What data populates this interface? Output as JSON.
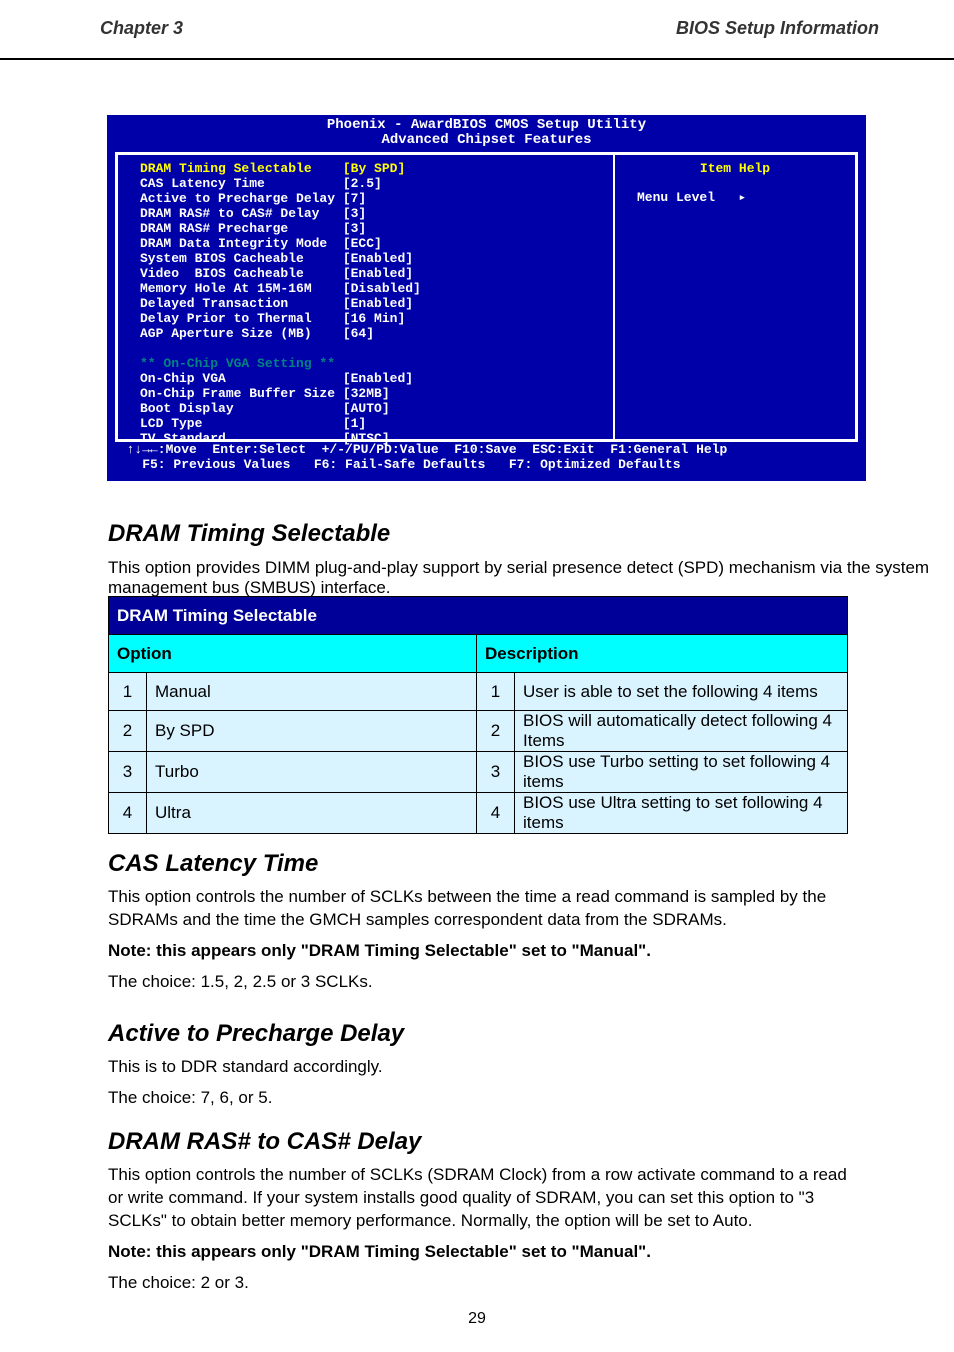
{
  "page": {
    "header_left": "Chapter 3",
    "header_right": "BIOS Setup Information",
    "number": "29"
  },
  "bios": {
    "title_line1": "Phoenix - AwardBIOS CMOS Setup Utility",
    "title_line2": "Advanced Chipset Features",
    "items": [
      {
        "label": "DRAM Timing Selectable",
        "value": "[By SPD]",
        "hl": true
      },
      {
        "label": "CAS Latency Time",
        "value": "[2.5]"
      },
      {
        "label": "Active to Precharge Delay",
        "value": "[7]"
      },
      {
        "label": "DRAM RAS# to CAS# Delay",
        "value": "[3]"
      },
      {
        "label": "DRAM RAS# Precharge",
        "value": "[3]"
      },
      {
        "label": "DRAM Data Integrity Mode",
        "value": "[ECC]"
      },
      {
        "label": "System BIOS Cacheable",
        "value": "[Enabled]"
      },
      {
        "label": "Video  BIOS Cacheable",
        "value": "[Enabled]"
      },
      {
        "label": "Memory Hole At 15M-16M",
        "value": "[Disabled]"
      },
      {
        "label": "Delayed Transaction",
        "value": "[Enabled]"
      },
      {
        "label": "Delay Prior to Thermal",
        "value": "[16 Min]"
      },
      {
        "label": "AGP Aperture Size (MB)",
        "value": "[64]"
      }
    ],
    "section_header": "** On-Chip VGA Setting **",
    "vga_items": [
      {
        "label": "On-Chip VGA",
        "value": "[Enabled]"
      },
      {
        "label": "On-Chip Frame Buffer Size",
        "value": "[32MB]"
      },
      {
        "label": "Boot Display",
        "value": "[AUTO]"
      },
      {
        "label": "LCD Type",
        "value": "[1]"
      },
      {
        "label": "TV Standard",
        "value": "[NTSC]"
      }
    ],
    "item_help": "Item Help",
    "menu_level": "Menu Level",
    "arrow": "▸",
    "footer1": "  ↑↓→←:Move  Enter:Select  +/-/PU/PD:Value  F10:Save  ESC:Exit  F1:General Help",
    "footer2": "    F5: Previous Values   F6: Fail-Safe Defaults   F7: Optimized Defaults"
  },
  "section": {
    "title": "DRAM Timing Selectable",
    "body": "This option provides DIMM plug-and-play support by serial presence detect (SPD) mechanism via the system management bus (SMBUS) interface.",
    "table_header": "DRAM Timing Selectable",
    "col1": "Option",
    "col2": "Description",
    "rows": [
      {
        "n1": "1",
        "opt": "Manual",
        "n2": "1",
        "desc": "User is able to set the following 4 items"
      },
      {
        "n1": "2",
        "opt": "By SPD",
        "n2": "2",
        "desc": "BIOS will automatically detect following 4 Items"
      },
      {
        "n1": "3",
        "opt": "Turbo",
        "n2": "3",
        "desc": "BIOS use Turbo setting to set following 4 items"
      },
      {
        "n1": "4",
        "opt": "Ultra",
        "n2": "4",
        "desc": "BIOS use Ultra setting to set following 4 items"
      }
    ]
  },
  "para2": {
    "title": "CAS Latency Time",
    "body": "This option controls the number of SCLKs between the time a read command is sampled by the SDRAMs and the time the GMCH samples correspondent data from the SDRAMs.",
    "note": "Note: this appears only \"DRAM Timing Selectable\" set to \"Manual\".",
    "body2": "The choice: 1.5, 2, 2.5 or 3 SCLKs."
  },
  "para3": {
    "title": "Active to Precharge Delay",
    "body": "This is to DDR standard accordingly.",
    "body2": "The choice: 7, 6, or 5."
  },
  "para4": {
    "title": "DRAM RAS# to CAS# Delay",
    "body": "This option controls the number of SCLKs (SDRAM Clock) from a row activate command to a read or write command. If your system installs good quality of SDRAM, you can set this option to \"3 SCLKs\" to obtain better memory performance. Normally, the option will be set to Auto.",
    "note": "Note: this appears only \"DRAM Timing Selectable\" set to \"Manual\".",
    "body2": "The choice: 2 or 3."
  }
}
